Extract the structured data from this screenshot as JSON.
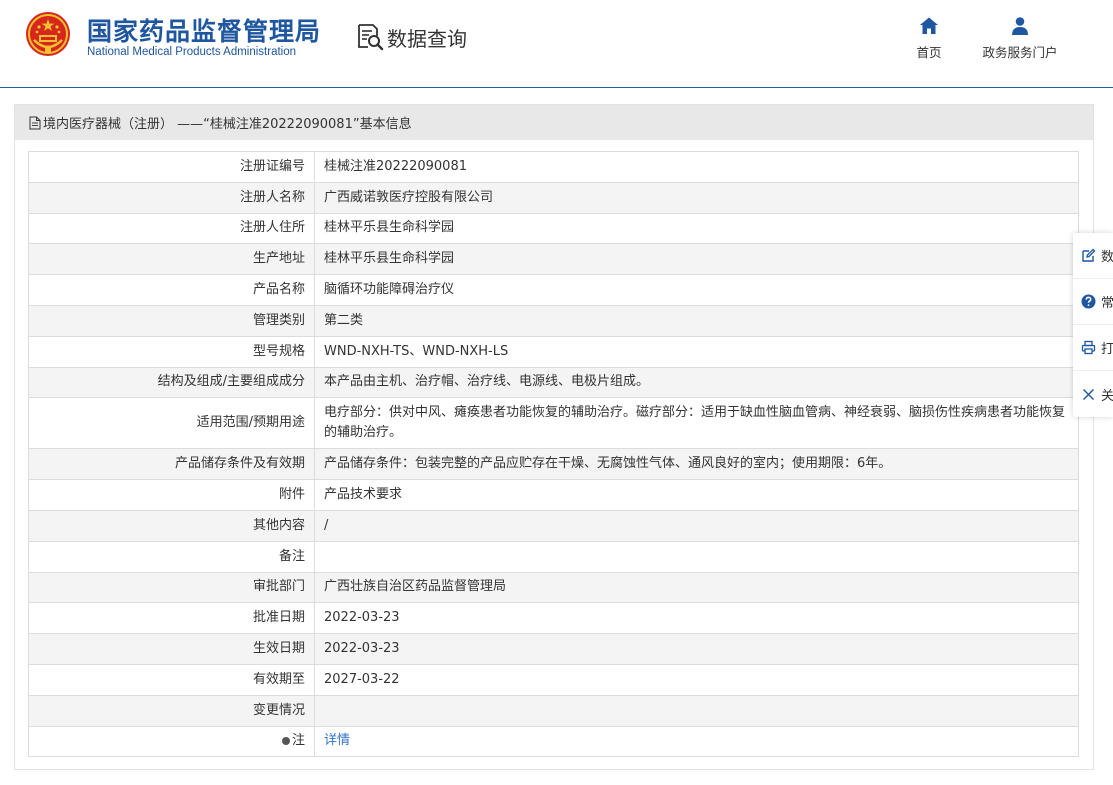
{
  "header": {
    "logo_cn": "国家药品监督管理局",
    "logo_en": "National Medical Products Administration",
    "query_label": "数据查询",
    "nav": [
      {
        "label": "首页",
        "icon": "home-icon"
      },
      {
        "label": "政务服务门户",
        "icon": "user-icon"
      }
    ]
  },
  "card": {
    "title": "境内医疗器械（注册） ——“桂械注准20222090081”基本信息"
  },
  "rows": [
    {
      "label": "注册证编号",
      "value": "桂械注准20222090081"
    },
    {
      "label": "注册人名称",
      "value": "广西威诺敦医疗控股有限公司"
    },
    {
      "label": "注册人住所",
      "value": "桂林平乐县生命科学园"
    },
    {
      "label": "生产地址",
      "value": "桂林平乐县生命科学园"
    },
    {
      "label": "产品名称",
      "value": "脑循环功能障碍治疗仪"
    },
    {
      "label": "管理类别",
      "value": "第二类"
    },
    {
      "label": "型号规格",
      "value": "WND-NXH-TS、WND-NXH-LS"
    },
    {
      "label": "结构及组成/主要组成成分",
      "value": "本产品由主机、治疗帽、治疗线、电源线、电极片组成。"
    },
    {
      "label": "适用范围/预期用途",
      "value": "电疗部分：供对中风、瘫痪患者功能恢复的辅助治疗。磁疗部分：适用于缺血性脑血管病、神经衰弱、脑损伤性疾病患者功能恢复的辅助治疗。"
    },
    {
      "label": "产品储存条件及有效期",
      "value": "产品储存条件：包装完整的产品应贮存在干燥、无腐蚀性气体、通风良好的室内；使用期限：6年。"
    },
    {
      "label": "附件",
      "value": "产品技术要求"
    },
    {
      "label": "其他内容",
      "value": "/"
    },
    {
      "label": "备注",
      "value": ""
    },
    {
      "label": "审批部门",
      "value": "广西壮族自治区药品监督管理局"
    },
    {
      "label": "批准日期",
      "value": "2022-03-23"
    },
    {
      "label": "生效日期",
      "value": "2022-03-23"
    },
    {
      "label": "有效期至",
      "value": "2027-03-22"
    },
    {
      "label": "变更情况",
      "value": ""
    },
    {
      "label": "注",
      "value": "详情"
    }
  ],
  "float_bar": [
    {
      "label": "数",
      "icon": "edit-icon"
    },
    {
      "label": "常",
      "icon": "question-icon"
    },
    {
      "label": "打",
      "icon": "print-icon"
    },
    {
      "label": "关",
      "icon": "close-icon"
    }
  ],
  "colors": {
    "brand": "#1e56a0",
    "link": "#2f73c9",
    "header_border": "#1f5ca8"
  }
}
